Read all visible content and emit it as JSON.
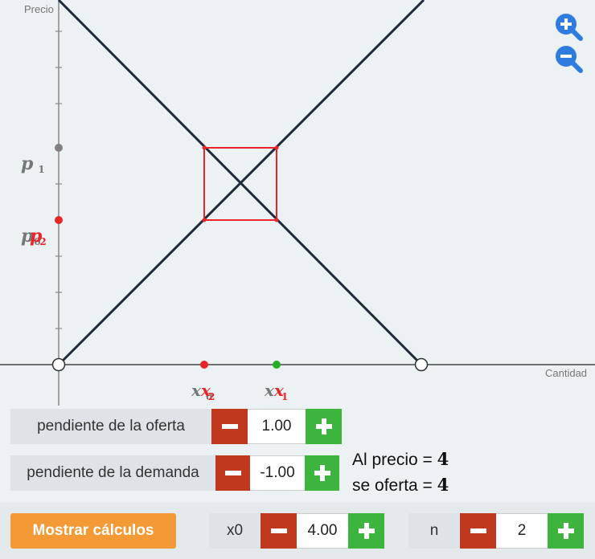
{
  "axes": {
    "y_label": "Precio",
    "x_label": "Cantidad"
  },
  "point_labels": {
    "p1": "p",
    "p1_sub": "1",
    "p0": "p",
    "p0_red": "p",
    "p0_sub": "0",
    "p0_red_sub": "2",
    "x0": "x",
    "x2": "x",
    "x0_sub": "0",
    "x2_sub": "2",
    "x1_black": "x",
    "x1_red": "x",
    "x1_sub": "1",
    "x1_red_sub": "1"
  },
  "controls": {
    "supply_slope": {
      "label": "pendiente de la oferta",
      "value": "1.00"
    },
    "demand_slope": {
      "label": "pendiente de la demanda",
      "value": "-1.00"
    },
    "x0": {
      "label": "x0",
      "value": "4.00"
    },
    "n": {
      "label": "n",
      "value": "2"
    }
  },
  "info": {
    "price_prefix": "Al precio = ",
    "price_value": "4",
    "offer_prefix": "se oferta = ",
    "offer_value": "4"
  },
  "buttons": {
    "show_calculations": "Mostrar cálculos"
  },
  "colors": {
    "line": "#1f2a3a",
    "cobweb": "#e8262a",
    "point_red": "#e8262a",
    "point_green": "#22b022",
    "point_gray": "#808080",
    "zoom": "#2f7ce0"
  },
  "icons": {
    "zoom_in": "zoom-in-icon",
    "zoom_out": "zoom-out-icon",
    "minus": "minus-icon",
    "plus": "plus-icon"
  }
}
